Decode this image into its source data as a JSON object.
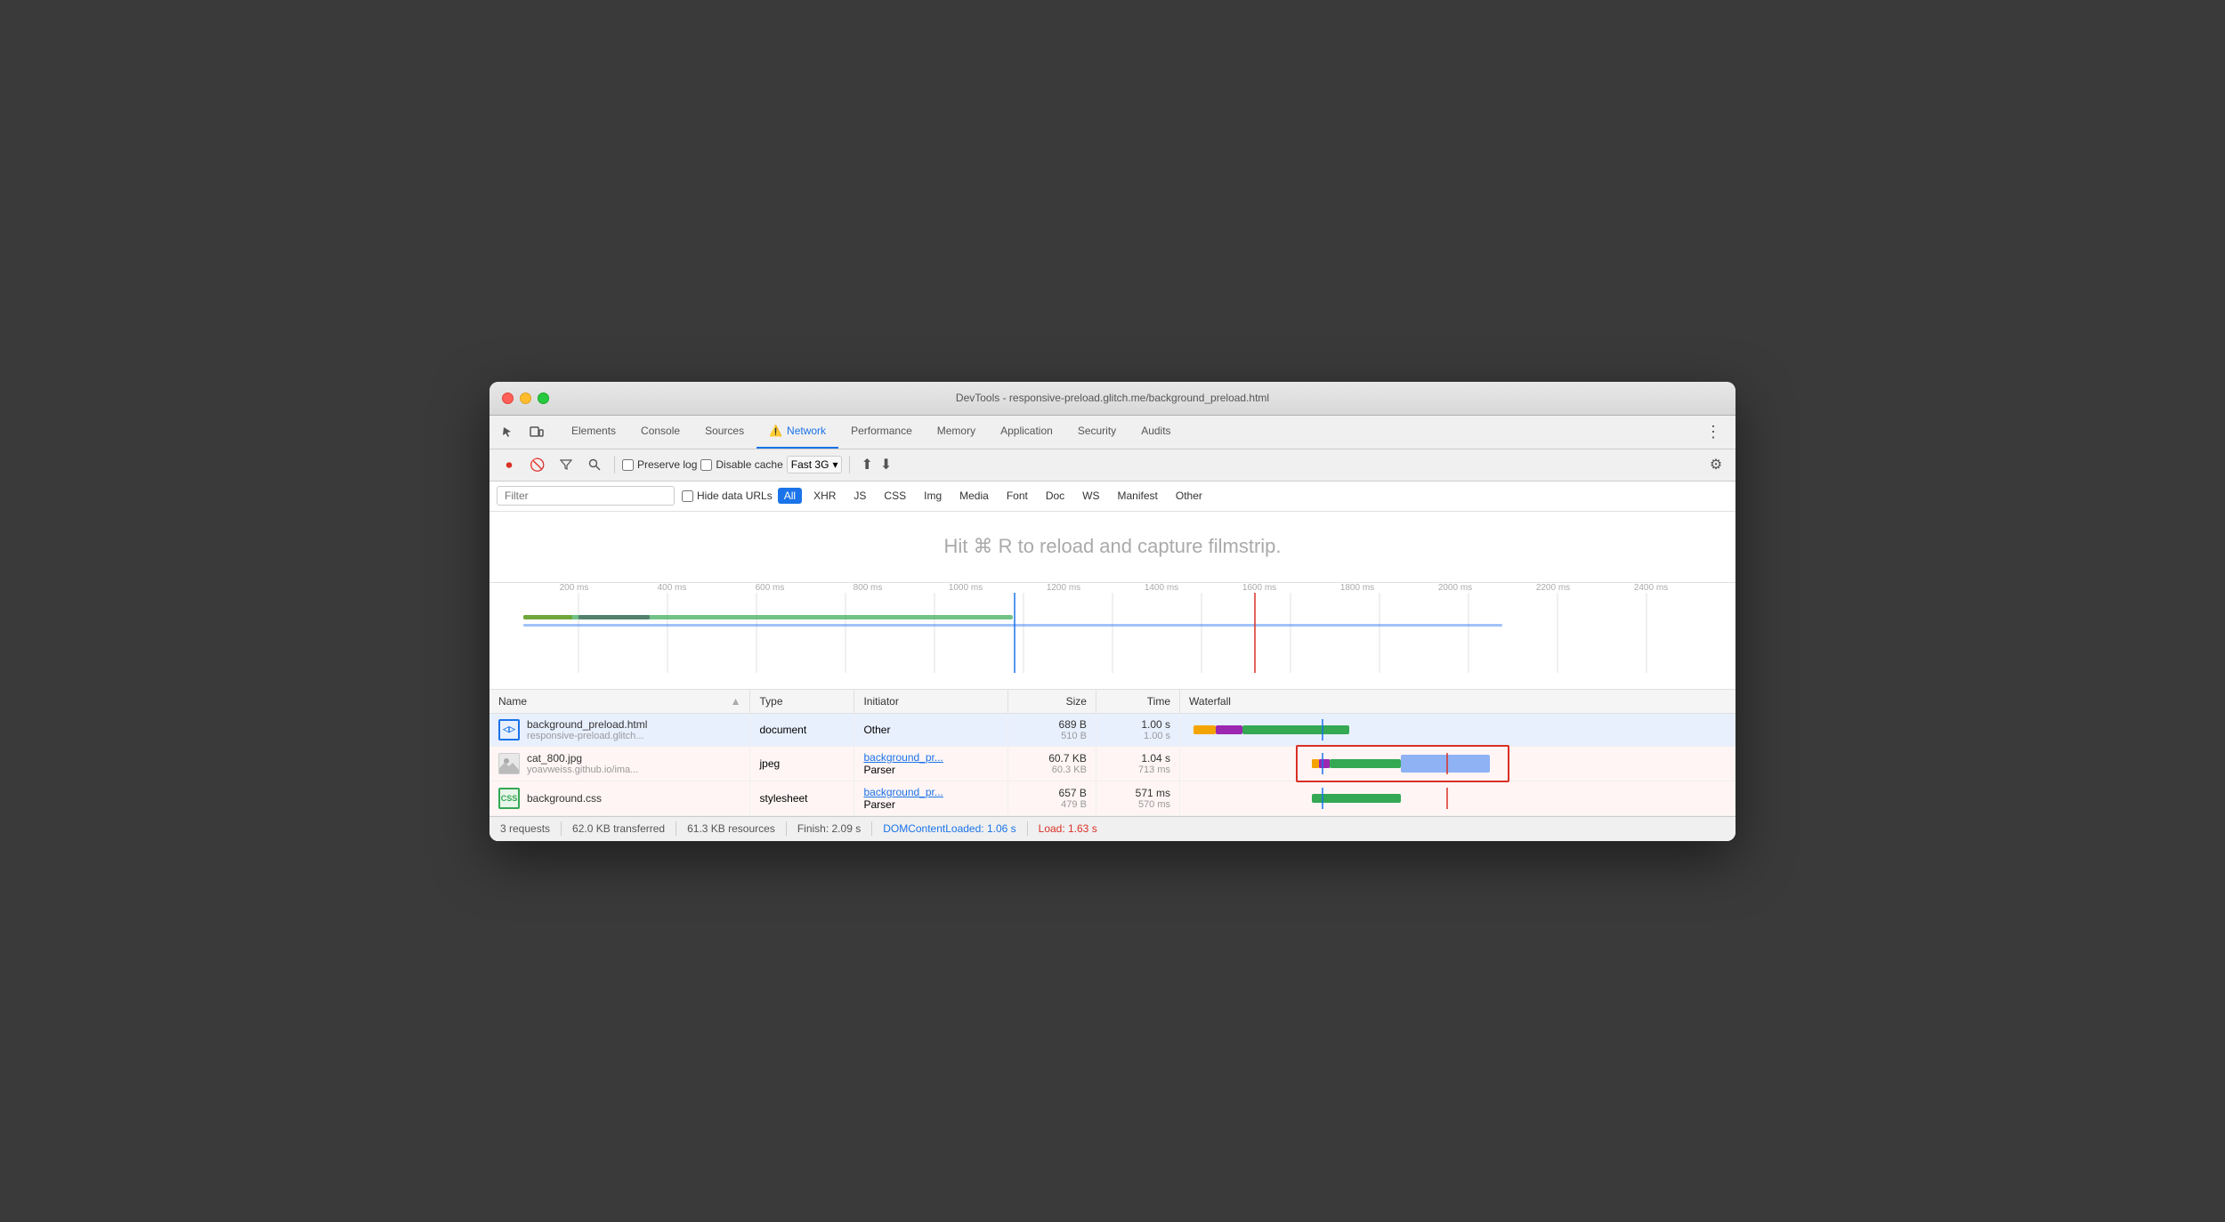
{
  "window": {
    "title": "DevTools - responsive-preload.glitch.me/background_preload.html"
  },
  "tabs": {
    "items": [
      {
        "label": "Elements",
        "active": false
      },
      {
        "label": "Console",
        "active": false
      },
      {
        "label": "Sources",
        "active": false
      },
      {
        "label": "Network",
        "active": true,
        "warning": true
      },
      {
        "label": "Performance",
        "active": false
      },
      {
        "label": "Memory",
        "active": false
      },
      {
        "label": "Application",
        "active": false
      },
      {
        "label": "Security",
        "active": false
      },
      {
        "label": "Audits",
        "active": false
      }
    ]
  },
  "toolbar": {
    "preserve_log": "Preserve log",
    "disable_cache": "Disable cache",
    "throttle": "Fast 3G"
  },
  "filter": {
    "placeholder": "Filter",
    "hide_data_urls": "Hide data URLs",
    "types": [
      "All",
      "XHR",
      "JS",
      "CSS",
      "Img",
      "Media",
      "Font",
      "Doc",
      "WS",
      "Manifest",
      "Other"
    ]
  },
  "filmstrip": {
    "message": "Hit ⌘ R to reload and capture filmstrip."
  },
  "ruler": {
    "labels": [
      "200 ms",
      "400 ms",
      "600 ms",
      "800 ms",
      "1000 ms",
      "1200 ms",
      "1400 ms",
      "1600 ms",
      "1800 ms",
      "2000 ms",
      "2200 ms",
      "2400 ms"
    ]
  },
  "table": {
    "headers": [
      "Name",
      "Type",
      "Initiator",
      "Size",
      "Time",
      "Waterfall"
    ],
    "rows": [
      {
        "name": "background_preload.html",
        "name2": "responsive-preload.glitch...",
        "icon_type": "html",
        "icon_label": "◁▷",
        "type": "document",
        "initiator": "Other",
        "initiator_link": false,
        "size1": "689 B",
        "size2": "510 B",
        "time1": "1.00 s",
        "time2": "1.00 s",
        "selected": true
      },
      {
        "name": "cat_800.jpg",
        "name2": "yoavweiss.github.io/ima...",
        "icon_type": "img",
        "icon_label": "🐱",
        "type": "jpeg",
        "initiator": "background_pr...",
        "initiator2": "Parser",
        "initiator_link": true,
        "size1": "60.7 KB",
        "size2": "60.3 KB",
        "time1": "1.04 s",
        "time2": "713 ms",
        "selected": false
      },
      {
        "name": "background.css",
        "name2": "",
        "icon_type": "css",
        "icon_label": "CSS",
        "type": "stylesheet",
        "initiator": "background_pr...",
        "initiator2": "Parser",
        "initiator_link": true,
        "size1": "657 B",
        "size2": "479 B",
        "time1": "571 ms",
        "time2": "570 ms",
        "selected": false
      }
    ]
  },
  "status_bar": {
    "requests": "3 requests",
    "transferred": "62.0 KB transferred",
    "resources": "61.3 KB resources",
    "finish": "Finish: 2.09 s",
    "dom_loaded": "DOMContentLoaded: 1.06 s",
    "load": "Load: 1.63 s"
  }
}
